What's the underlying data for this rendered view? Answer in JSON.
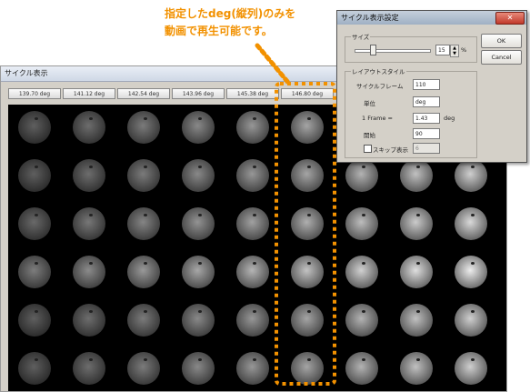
{
  "callout": {
    "line1": "指定したdeg(縦列)のみを",
    "line2": "動画で再生可能です。",
    "color": "#f29100"
  },
  "main_window": {
    "title": "サイクル表示",
    "columns": [
      "139.70 deg",
      "141.12 deg",
      "142.54 deg",
      "143.96 deg",
      "145.38 deg",
      "146.80 deg"
    ]
  },
  "dialog": {
    "title": "サイクル表示設定",
    "close_label": "✕",
    "ok_label": "OK",
    "cancel_label": "Cancel",
    "size_group": "サイズ",
    "size_value": "15",
    "size_unit": "%",
    "layout_group": "レイアウトスタイル",
    "cycle_frame_label": "サイクルフレーム",
    "cycle_frame_value": "110",
    "unit_label": "単位",
    "unit_value": "deg",
    "frame_label": "1 Frame  =",
    "frame_value": "1.43",
    "frame_unit": "deg",
    "start_label": "開始",
    "start_value": "90",
    "skip_label": "スキップ表示",
    "skip_value": "6"
  }
}
